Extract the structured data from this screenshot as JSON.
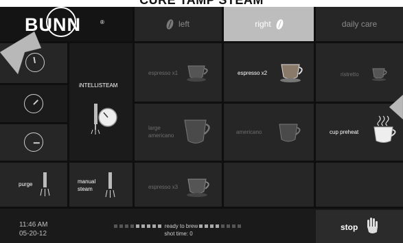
{
  "banner": {
    "title": "CURE TAMP STEAM"
  },
  "logo": {
    "text": "BUNN",
    "registered": "®"
  },
  "tabs": [
    {
      "label": "left",
      "icon": "coffee-bean-icon",
      "selected": false
    },
    {
      "label": "right",
      "icon": "coffee-bean-icon",
      "selected": true
    },
    {
      "label": "daily care",
      "selected": false
    }
  ],
  "steam_panel": {
    "label": "iNTELLISTEAM"
  },
  "buttons": {
    "purge": "purge",
    "manual_steam_line1": "manual",
    "manual_steam_line2": "steam"
  },
  "drinks": {
    "espresso_x1": "espresso x1",
    "espresso_x2": "espresso x2",
    "ristretto": "ristretto",
    "large_americano_line1": "large",
    "large_americano_line2": "americano",
    "americano": "americano",
    "cup_preheat": "cup preheat",
    "espresso_x3": "espresso x3"
  },
  "footer": {
    "time": "11:46 AM",
    "date": "05-20-12",
    "status": "ready to brew",
    "shot_time": "shot time: 0",
    "stop": "stop"
  },
  "colors": {
    "background": "#0f0f0f",
    "cell": "#262626",
    "selected_tab": "#bdbdbd",
    "callout_arrow": "#b8b8b8"
  }
}
